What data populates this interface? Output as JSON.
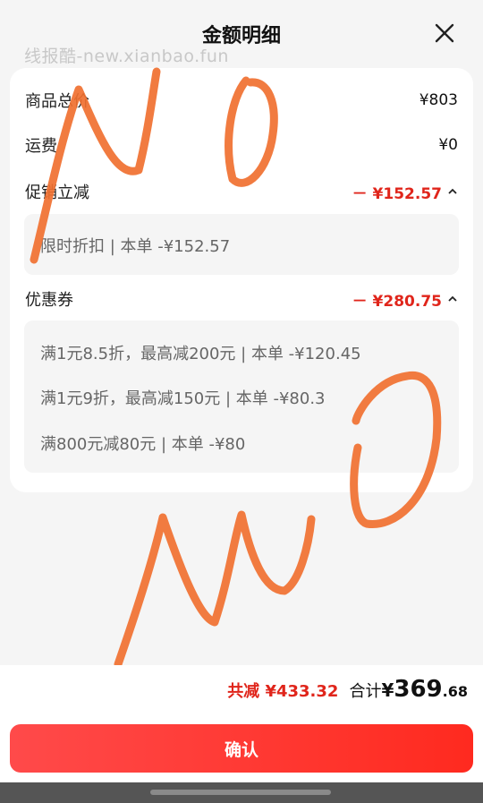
{
  "header": {
    "title": "金额明细",
    "watermark": "线报酷-new.xianbao.fun"
  },
  "rows": {
    "price": {
      "label": "商品总价",
      "value": "¥803"
    },
    "shipping": {
      "label": "运费",
      "value": "¥0"
    },
    "promo": {
      "label": "促销立减",
      "value": "－ ¥152.57",
      "details": [
        "限时折扣 | 本单 -¥152.57"
      ]
    },
    "coupon": {
      "label": "优惠券",
      "value": "－ ¥280.75",
      "details": [
        "满1元8.5折，最高减200元 | 本单 -¥120.45",
        "满1元9折，最高减150元 | 本单 -¥80.3",
        "满800元减80元 | 本单 -¥80"
      ]
    }
  },
  "summary": {
    "saved": "共减 ¥433.32",
    "total_label": "合计",
    "total_symbol": "¥",
    "total_int": "369",
    "total_dec": ".68"
  },
  "confirm_label": "确认",
  "colors": {
    "accent_red": "#e0251b",
    "scribble": "#f07030",
    "button_gradient_start": "#ff4a4a",
    "button_gradient_end": "#ff2a1f"
  },
  "icons": {
    "close": "close-icon",
    "chevron": "chevron-up-icon"
  }
}
